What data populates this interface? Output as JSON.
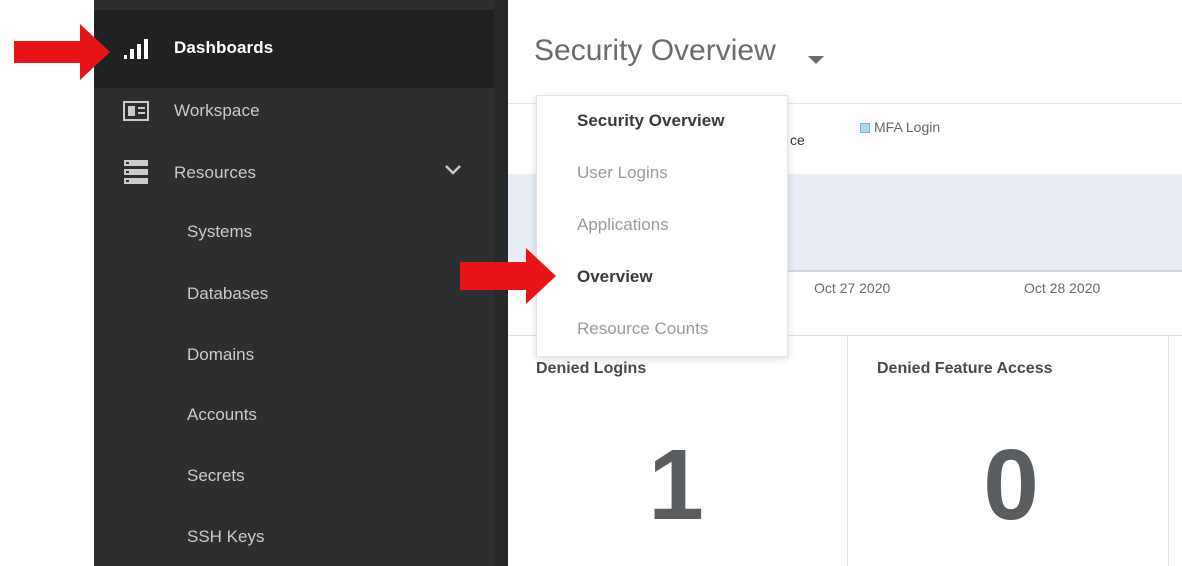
{
  "sidebar": {
    "items": [
      {
        "label": "Dashboards",
        "icon": "bar-chart-icon",
        "active": true
      },
      {
        "label": "Workspace",
        "icon": "id-card-icon"
      },
      {
        "label": "Resources",
        "icon": "server-icon",
        "expanded": true
      }
    ],
    "sub_items": [
      {
        "label": "Systems"
      },
      {
        "label": "Databases"
      },
      {
        "label": "Domains"
      },
      {
        "label": "Accounts"
      },
      {
        "label": "Secrets"
      },
      {
        "label": "SSH Keys"
      }
    ]
  },
  "header": {
    "title": "Security Overview",
    "caret_icon": "caret-down-icon"
  },
  "dropdown": {
    "items": [
      {
        "label": "Security Overview",
        "selected": true
      },
      {
        "label": "User Logins"
      },
      {
        "label": "Applications"
      },
      {
        "label": "Overview",
        "highlighted": true
      },
      {
        "label": "Resource Counts"
      }
    ]
  },
  "chart": {
    "legend_fragment": "ce",
    "legend_label": "MFA Login",
    "x_ticks": [
      "Oct 27 2020",
      "Oct 28 2020"
    ]
  },
  "cards": [
    {
      "title": "Denied Logins",
      "value": "1"
    },
    {
      "title": "Denied Feature Access",
      "value": "0"
    }
  ],
  "annotations": {
    "arrow_color": "#e8141a"
  },
  "colors": {
    "sidebar_bg": "#2c2e30",
    "sidebar_active_bg": "#1f2123",
    "chart_band": "#e8edf6"
  }
}
